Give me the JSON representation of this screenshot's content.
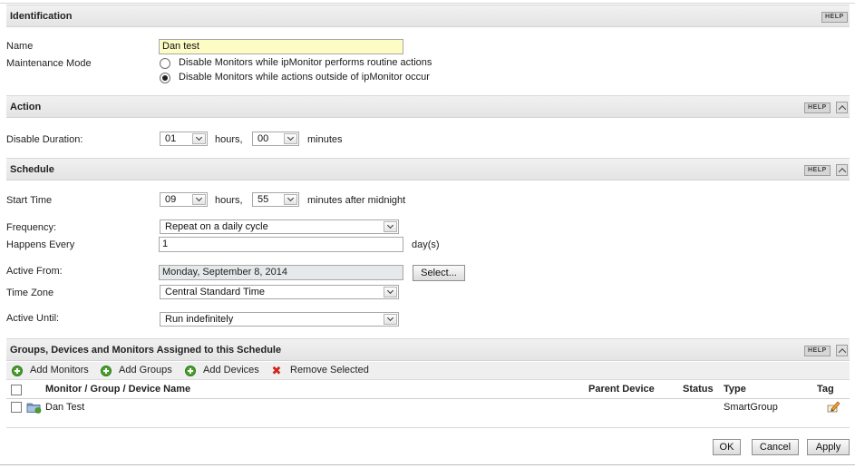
{
  "identification": {
    "title": "Identification",
    "help": "HELP",
    "name_label": "Name",
    "name_value": "Dan test",
    "maintenance_label": "Maintenance Mode",
    "options": [
      {
        "label": "Disable Monitors while ipMonitor performs routine actions",
        "selected": false
      },
      {
        "label": "Disable Monitors while actions outside of ipMonitor occur",
        "selected": true
      }
    ]
  },
  "action": {
    "title": "Action",
    "help": "HELP",
    "duration_label": "Disable Duration:",
    "hours_value": "01",
    "hours_unit": "hours,",
    "minutes_value": "00",
    "minutes_unit": "minutes"
  },
  "schedule": {
    "title": "Schedule",
    "help": "HELP",
    "start_label": "Start Time",
    "start_hours": "09",
    "hours_unit": "hours,",
    "start_minutes": "55",
    "minutes_unit": "minutes after midnight",
    "frequency_label": "Frequency:",
    "frequency_value": "Repeat on a daily cycle",
    "happens_label": "Happens Every",
    "happens_value": "1",
    "happens_unit": "day(s)",
    "active_from_label": "Active From:",
    "active_from_value": "Monday, September 8, 2014",
    "select_button": "Select...",
    "timezone_label": "Time Zone",
    "timezone_value": "Central Standard Time",
    "active_until_label": "Active Until:",
    "active_until_value": "Run indefinitely"
  },
  "assigned": {
    "title": "Groups, Devices and Monitors Assigned to this Schedule",
    "help": "HELP",
    "toolbar": {
      "add_monitors": "Add Monitors",
      "add_groups": "Add Groups",
      "add_devices": "Add Devices",
      "remove_selected": "Remove Selected"
    },
    "columns": {
      "name": "Monitor / Group / Device Name",
      "parent": "Parent Device",
      "status": "Status",
      "type": "Type",
      "tag": "Tag"
    },
    "rows": [
      {
        "name": "Dan Test",
        "parent": "",
        "status": "",
        "type": "SmartGroup",
        "icon": "folder-group-icon",
        "tag_icon": "edit-tag-icon"
      }
    ]
  },
  "footer": {
    "ok": "OK",
    "cancel": "Cancel",
    "apply": "Apply"
  }
}
